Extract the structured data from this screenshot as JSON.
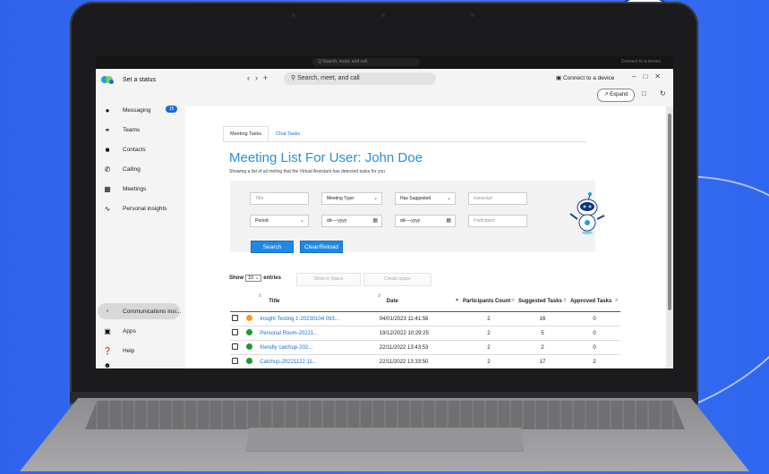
{
  "topbar": {
    "search_placeholder": "Q  Search, meet, and call",
    "connect_small": "Connect to a device"
  },
  "sidebar": {
    "status": "Set a status",
    "items": [
      {
        "label": "Messaging",
        "icon": "chat-icon",
        "badge": "15"
      },
      {
        "label": "Teams",
        "icon": "teams-icon"
      },
      {
        "label": "Contacts",
        "icon": "contacts-icon"
      },
      {
        "label": "Calling",
        "icon": "phone-icon"
      },
      {
        "label": "Meetings",
        "icon": "calendar-icon"
      },
      {
        "label": "Personal insights",
        "icon": "insights-icon"
      }
    ],
    "bottom": [
      {
        "label": "Communications insi...",
        "icon": "bullet-icon"
      },
      {
        "label": "Apps",
        "icon": "apps-icon"
      },
      {
        "label": "Help",
        "icon": "help-icon"
      }
    ]
  },
  "header": {
    "search_placeholder": "Search, meet, and call",
    "connect": "Connect to a device",
    "expand": "Expand"
  },
  "content": {
    "tabs": [
      "Meeting Tasks",
      "Chat Tasks"
    ],
    "title": "Meeting List For User: John Doe",
    "subtitle": "Showing a list of all meting that the Virtual Assistant has detected tasks for you",
    "filters": {
      "title_placeholder": "Title:",
      "meeting_type": "Meeting Type:",
      "has_suggested": "Has Suggested",
      "transcript_placeholder": "transcript:",
      "period": "Period:",
      "date_from": "dd----yyyy",
      "date_to": "dd----yyyy",
      "participant_placeholder": "Participant:"
    },
    "search_button": "Search",
    "clear_button": "Clear/Reload",
    "show_label": "Show",
    "show_value": "10",
    "entries_label": "entries",
    "show_in_space": "Show in Space",
    "create_space": "Create space",
    "columns": [
      "Title",
      "Date",
      "Participants Count",
      "Suggested Tasks",
      "Approved Tasks"
    ],
    "rows": [
      {
        "status": "#f59d1c",
        "title": "Insight Testing 1-20230104 093...",
        "date": "04/01/2023 11:41:56",
        "participants": "2",
        "suggested": "16",
        "approved": "0"
      },
      {
        "status": "#1a9a2a",
        "title": "Personal Room-20221...",
        "date": "19/12/2022 10:29:25",
        "participants": "2",
        "suggested": "5",
        "approved": "0"
      },
      {
        "status": "#1a9a2a",
        "title": "friendly catchup-202...",
        "date": "22/11/2022 13:43:53",
        "participants": "2",
        "suggested": "2",
        "approved": "0"
      },
      {
        "status": "#1a9a2a",
        "title": "Catchup-20221122 11...",
        "date": "22/11/2022 13:33:50",
        "participants": "2",
        "suggested": "17",
        "approved": "2"
      }
    ]
  },
  "colors": {
    "background": "#3a72f2",
    "accent": "#1e88e5",
    "title_blue": "#2a8fd6"
  }
}
